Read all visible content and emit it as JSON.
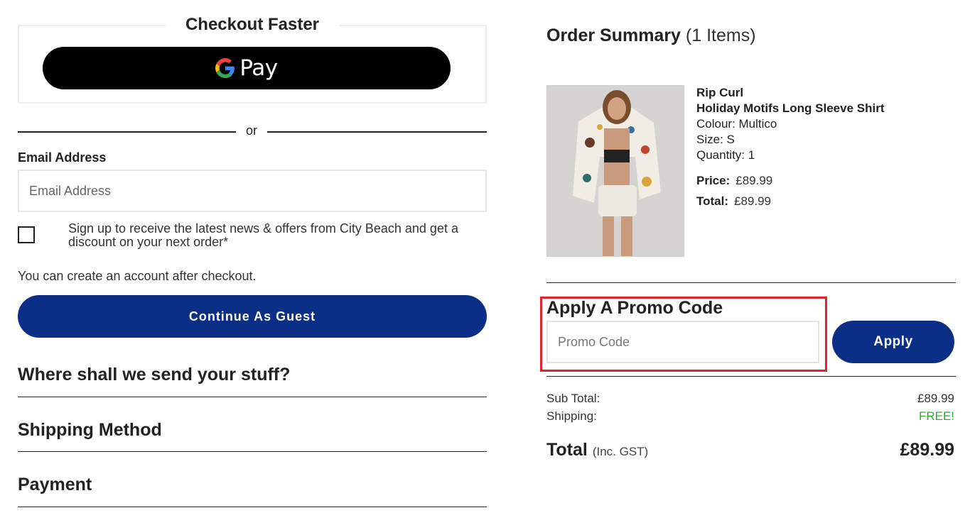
{
  "checkout_faster": {
    "title": "Checkout Faster",
    "gpay_label": "Pay"
  },
  "divider_text": "or",
  "email": {
    "label": "Email Address",
    "placeholder": "Email Address",
    "value": ""
  },
  "signup": {
    "checked": false,
    "text": "Sign up to receive the latest news & offers from City Beach and get a discount on your next order*"
  },
  "account_note": "You can create an account after checkout.",
  "guest_button_label": "Continue As Guest",
  "sections": {
    "shipping_address": "Where shall we send your stuff?",
    "shipping_method": "Shipping Method",
    "payment": "Payment"
  },
  "order_summary": {
    "title": "Order Summary",
    "count": "(1 Items)",
    "product": {
      "brand": "Rip Curl",
      "name": "Holiday Motifs Long Sleeve Shirt",
      "colour": "Colour: Multico",
      "size": "Size: S",
      "quantity": "Quantity: 1",
      "price_label": "Price:",
      "price": "£89.99",
      "total_label": "Total:",
      "total": "£89.99"
    },
    "promo": {
      "title": "Apply A Promo Code",
      "placeholder": "Promo Code",
      "apply_label": "Apply"
    },
    "subtotal_label": "Sub Total:",
    "subtotal": "£89.99",
    "shipping_label": "Shipping:",
    "shipping": "FREE!",
    "grand_total_label": "Total",
    "grand_total_note": "(Inc. GST)",
    "grand_total": "£89.99"
  },
  "colors": {
    "primary_button": "#0b2e86",
    "highlight_border": "#e0242c",
    "free_text": "#2eaa3a"
  }
}
